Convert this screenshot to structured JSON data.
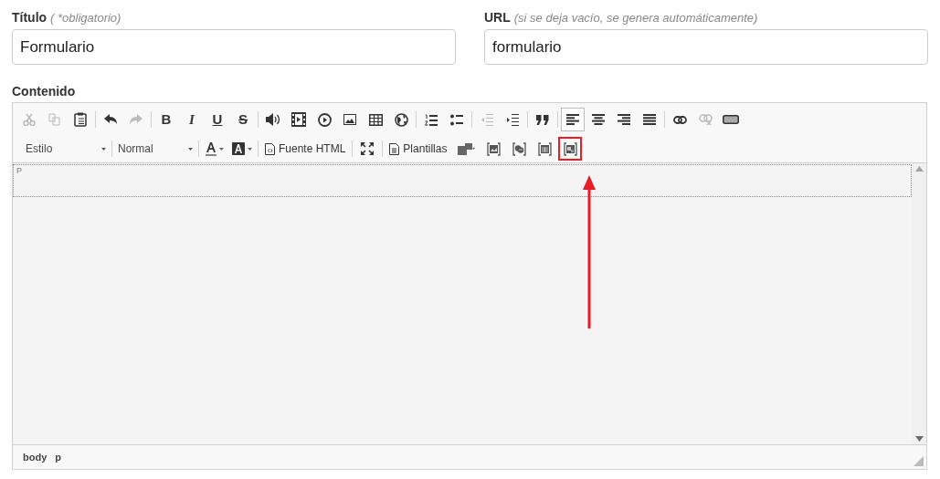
{
  "fields": [
    {
      "label": "Título",
      "hint": "( *obligatorio)",
      "value": "Formulario"
    },
    {
      "label": "URL",
      "hint": "(si se deja vacío, se genera automáticamente)",
      "value": "formulario"
    }
  ],
  "editor": {
    "label": "Contenido",
    "toolbar_rows": [
      [
        {
          "kind": "cut",
          "disabled": true
        },
        {
          "kind": "copy",
          "disabled": true
        },
        {
          "kind": "paste",
          "disabled": false
        },
        {
          "kind": "separator"
        },
        {
          "kind": "undo",
          "disabled": false
        },
        {
          "kind": "redo",
          "disabled": true
        },
        {
          "kind": "separator"
        },
        {
          "kind": "letter",
          "text": "B",
          "disabled": false
        },
        {
          "kind": "letter",
          "text": "I",
          "disabled": false
        },
        {
          "kind": "letter",
          "text": "U",
          "disabled": false
        },
        {
          "kind": "letter",
          "text": "S",
          "disabled": false
        },
        {
          "kind": "separator"
        },
        {
          "kind": "audio",
          "disabled": false
        },
        {
          "kind": "video",
          "disabled": false
        },
        {
          "kind": "play",
          "disabled": false
        },
        {
          "kind": "image",
          "disabled": false
        },
        {
          "kind": "table",
          "disabled": false
        },
        {
          "kind": "globe",
          "disabled": false
        },
        {
          "kind": "separator"
        },
        {
          "kind": "ol",
          "disabled": false
        },
        {
          "kind": "ul",
          "disabled": false
        },
        {
          "kind": "separator"
        },
        {
          "kind": "outdent",
          "disabled": true
        },
        {
          "kind": "indent",
          "disabled": false
        },
        {
          "kind": "separator"
        },
        {
          "kind": "quote",
          "disabled": false
        },
        {
          "kind": "separator"
        },
        {
          "kind": "align-left",
          "disabled": false,
          "selected": true
        },
        {
          "kind": "align-center",
          "disabled": false,
          "selected": false
        },
        {
          "kind": "align-right",
          "disabled": false,
          "selected": false
        },
        {
          "kind": "justify",
          "disabled": false,
          "selected": false
        },
        {
          "kind": "separator"
        },
        {
          "kind": "link",
          "disabled": false
        },
        {
          "kind": "unlink",
          "disabled": true
        },
        {
          "kind": "field",
          "disabled": false
        }
      ],
      [
        {
          "kind": "combo",
          "text": "Estilo"
        },
        {
          "kind": "separator"
        },
        {
          "kind": "combo",
          "text": "Normal"
        },
        {
          "kind": "separator"
        },
        {
          "kind": "text-color",
          "disabled": false
        },
        {
          "kind": "bg-color",
          "disabled": false
        },
        {
          "kind": "separator"
        },
        {
          "kind": "source",
          "text": "Fuente HTML",
          "disabled": false
        },
        {
          "kind": "separator"
        },
        {
          "kind": "maximize",
          "disabled": false
        },
        {
          "kind": "separator"
        },
        {
          "kind": "templates",
          "text": "Plantillas",
          "disabled": false
        },
        {
          "kind": "layout"
        },
        {
          "kind": "image-frame"
        },
        {
          "kind": "mask-frame"
        },
        {
          "kind": "card-frame"
        },
        {
          "kind": "gallery-frame",
          "highlighted": true
        }
      ]
    ],
    "block_tag": "P",
    "path": [
      "body",
      "p"
    ]
  }
}
